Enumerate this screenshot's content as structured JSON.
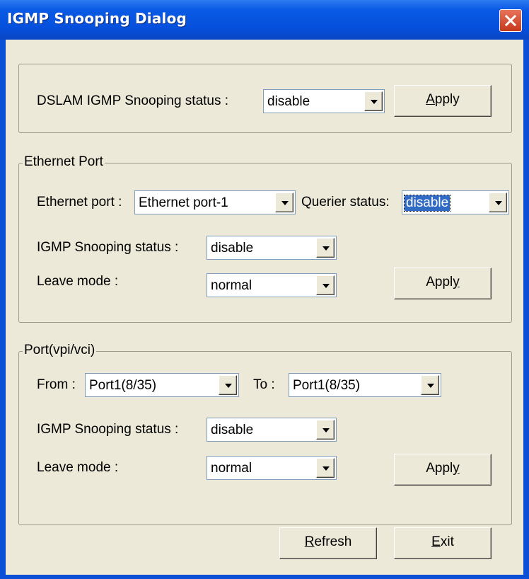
{
  "window": {
    "title": "IGMP Snooping Dialog"
  },
  "dslam": {
    "label": "DSLAM IGMP Snooping status :",
    "status": "disable",
    "apply": {
      "mnemonic": "A",
      "rest": "pply"
    }
  },
  "ethernet": {
    "legend": "Ethernet Port",
    "port_label": "Ethernet port :",
    "port_value": "Ethernet port-1",
    "querier_label": "Querier status:",
    "querier_value": "disable",
    "snooping_label": "IGMP Snooping status :",
    "snooping_value": "disable",
    "leave_label": "Leave mode :",
    "leave_value": "normal",
    "apply": {
      "before": "Appl",
      "mnemonic": "y"
    }
  },
  "vpi": {
    "legend": "Port(vpi/vci)",
    "from_label": "From :",
    "from_value": "Port1(8/35)",
    "to_label": "To :",
    "to_value": "Port1(8/35)",
    "snooping_label": "IGMP Snooping status :",
    "snooping_value": "disable",
    "leave_label": "Leave mode :",
    "leave_value": "normal",
    "apply": {
      "before": "Appl",
      "mnemonic": "y"
    }
  },
  "footer": {
    "refresh": {
      "mnemonic": "R",
      "rest": "efresh"
    },
    "exit": {
      "mnemonic": "E",
      "rest": "xit"
    }
  },
  "icons": {
    "close": "close-icon",
    "dropdown": "chevron-down-icon"
  },
  "colors": {
    "titlebar": "#0a5ae4",
    "close": "#c5391b",
    "selection": "#316ac5",
    "face": "#ece9d8"
  }
}
